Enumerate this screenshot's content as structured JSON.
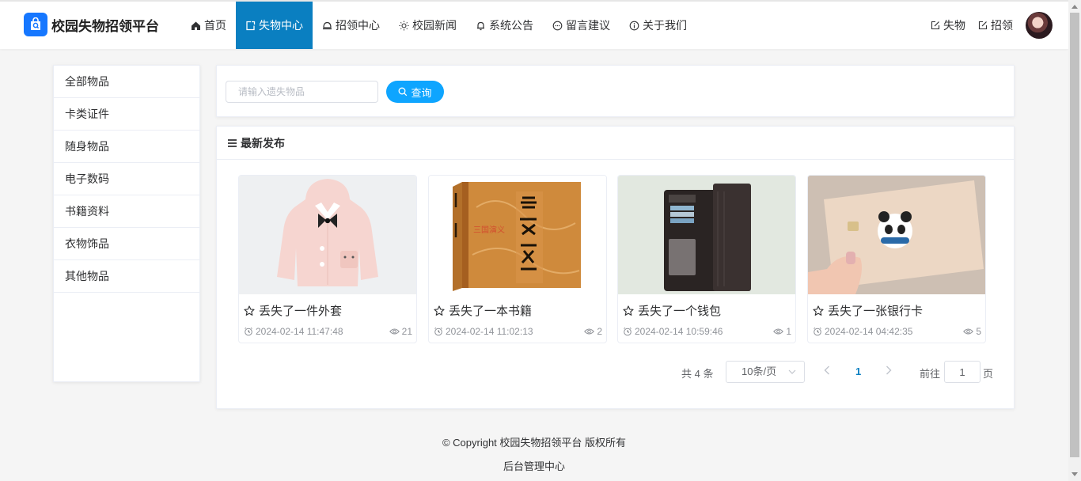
{
  "brand": {
    "name": "校园失物招领平台",
    "logo_icon": "shopping-bag-search-icon",
    "accent": "#1677ff"
  },
  "nav": {
    "items": [
      {
        "label": "首页",
        "icon": "home-icon",
        "active": false
      },
      {
        "label": "失物中心",
        "icon": "external-doc-icon",
        "active": true
      },
      {
        "label": "招领中心",
        "icon": "bell-outline-icon",
        "active": false
      },
      {
        "label": "校园新闻",
        "icon": "sun-icon",
        "active": false
      },
      {
        "label": "系统公告",
        "icon": "bell-icon",
        "active": false
      },
      {
        "label": "留言建议",
        "icon": "chat-icon",
        "active": false
      },
      {
        "label": "关于我们",
        "icon": "info-icon",
        "active": false
      }
    ],
    "active_color": "#0a7fc1"
  },
  "header_actions": {
    "lost_label": "失物",
    "found_label": "招领"
  },
  "sidebar": {
    "items": [
      {
        "label": "全部物品"
      },
      {
        "label": "卡类证件"
      },
      {
        "label": "随身物品"
      },
      {
        "label": "电子数码"
      },
      {
        "label": "书籍资料"
      },
      {
        "label": "衣物饰品"
      },
      {
        "label": "其他物品"
      }
    ]
  },
  "search": {
    "placeholder": "请输入遗失物品",
    "value": "",
    "button_label": "查询",
    "button_color": "#0ea5ff"
  },
  "list": {
    "heading": "最新发布",
    "cards": [
      {
        "title": "丢失了一件外套",
        "time": "2024-02-14 11:47:48",
        "views": "21",
        "image": "pink-coat"
      },
      {
        "title": "丢失了一本书籍",
        "time": "2024-02-14 11:02:13",
        "views": "2",
        "image": "book-sanguo"
      },
      {
        "title": "丢失了一个钱包",
        "time": "2024-02-14 10:59:46",
        "views": "1",
        "image": "black-wallet"
      },
      {
        "title": "丢失了一张银行卡",
        "time": "2024-02-14 04:42:35",
        "views": "5",
        "image": "bank-card"
      }
    ]
  },
  "pagination": {
    "total": "共 4 条",
    "page_size": "10条/页",
    "current": "1",
    "goto_label": "前往",
    "goto_value": "1",
    "page_suffix": "页"
  },
  "footer": {
    "copyright": "© Copyright 校园失物招领平台 版权所有",
    "admin_link": "后台管理中心"
  }
}
